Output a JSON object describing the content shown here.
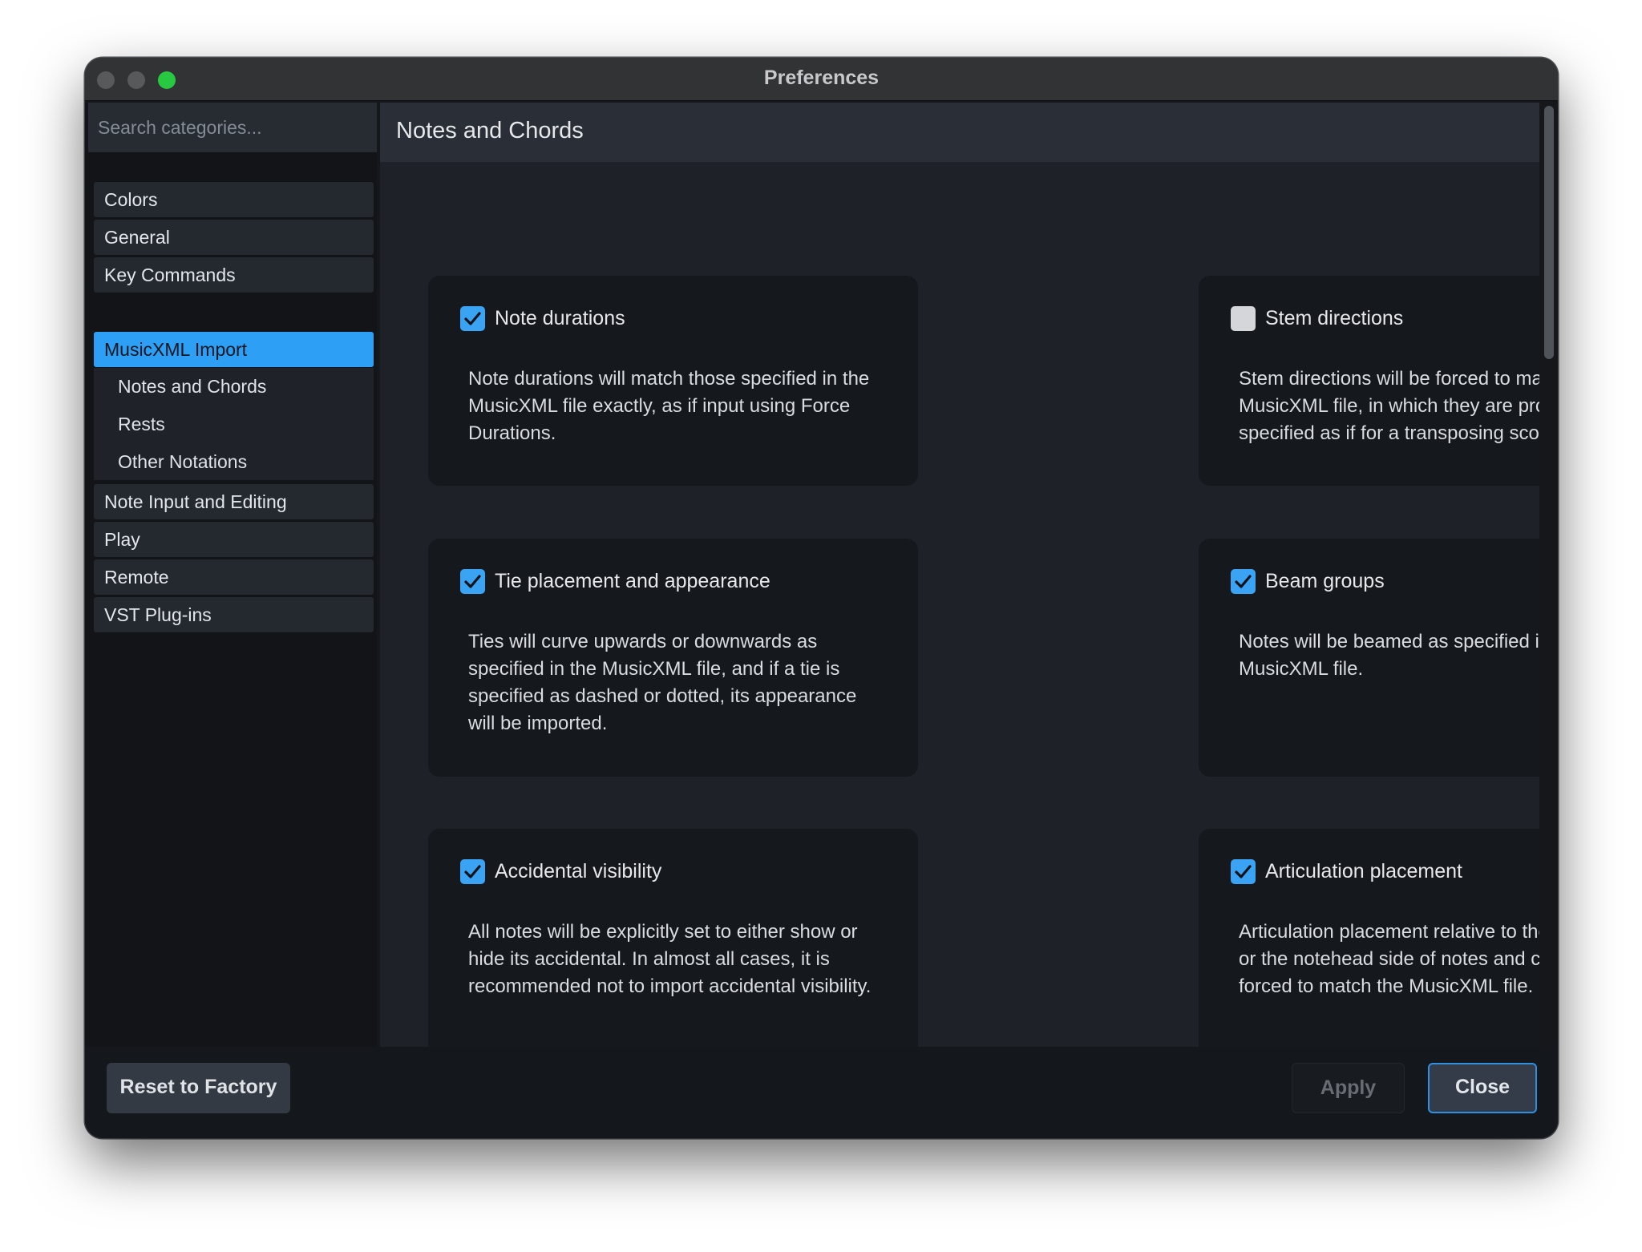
{
  "window": {
    "title": "Preferences"
  },
  "sidebar": {
    "search_placeholder": "Search categories...",
    "items": [
      {
        "label": "Colors"
      },
      {
        "label": "General"
      },
      {
        "label": "Key Commands"
      },
      {
        "label": "MusicXML Import",
        "selected": true
      },
      {
        "label": "Note Input and Editing"
      },
      {
        "label": "Play"
      },
      {
        "label": "Remote"
      },
      {
        "label": "VST Plug-ins"
      }
    ],
    "subitems": [
      {
        "label": "Notes and Chords"
      },
      {
        "label": "Rests"
      },
      {
        "label": "Other Notations"
      }
    ]
  },
  "main": {
    "title": "Notes and Chords",
    "options": [
      {
        "label": "Note durations",
        "checked": true,
        "description": "Note durations will match those specified in the MusicXML file exactly, as if input using Force Durations."
      },
      {
        "label": "Stem directions",
        "checked": false,
        "description": "Stem directions will be forced to match the MusicXML file, in which they are probably specified as if for a transposing score."
      },
      {
        "label": "Tie placement and appearance",
        "checked": true,
        "description": "Ties will curve upwards or downwards as specified in the MusicXML file, and if a tie is specified as dashed or dotted, its appearance will be imported."
      },
      {
        "label": "Beam groups",
        "checked": true,
        "description": "Notes will be beamed as specified in the MusicXML file."
      },
      {
        "label": "Accidental visibility",
        "checked": true,
        "description": "All notes will be explicitly set to either show or hide its accidental. In almost all cases, it is recommended not to import accidental visibility."
      },
      {
        "label": "Articulation placement",
        "checked": true,
        "description": "Articulation placement relative to the stem side or the notehead side of notes and chords will be forced to match the MusicXML file."
      }
    ]
  },
  "footer": {
    "reset_label": "Reset to Factory",
    "apply_label": "Apply",
    "close_label": "Close"
  },
  "colors": {
    "accent": "#2d9ff5",
    "checkbox_on": "#3aa3f3",
    "maximize": "#28c840"
  },
  "icons": {
    "checkmark": "checkmark-icon"
  }
}
